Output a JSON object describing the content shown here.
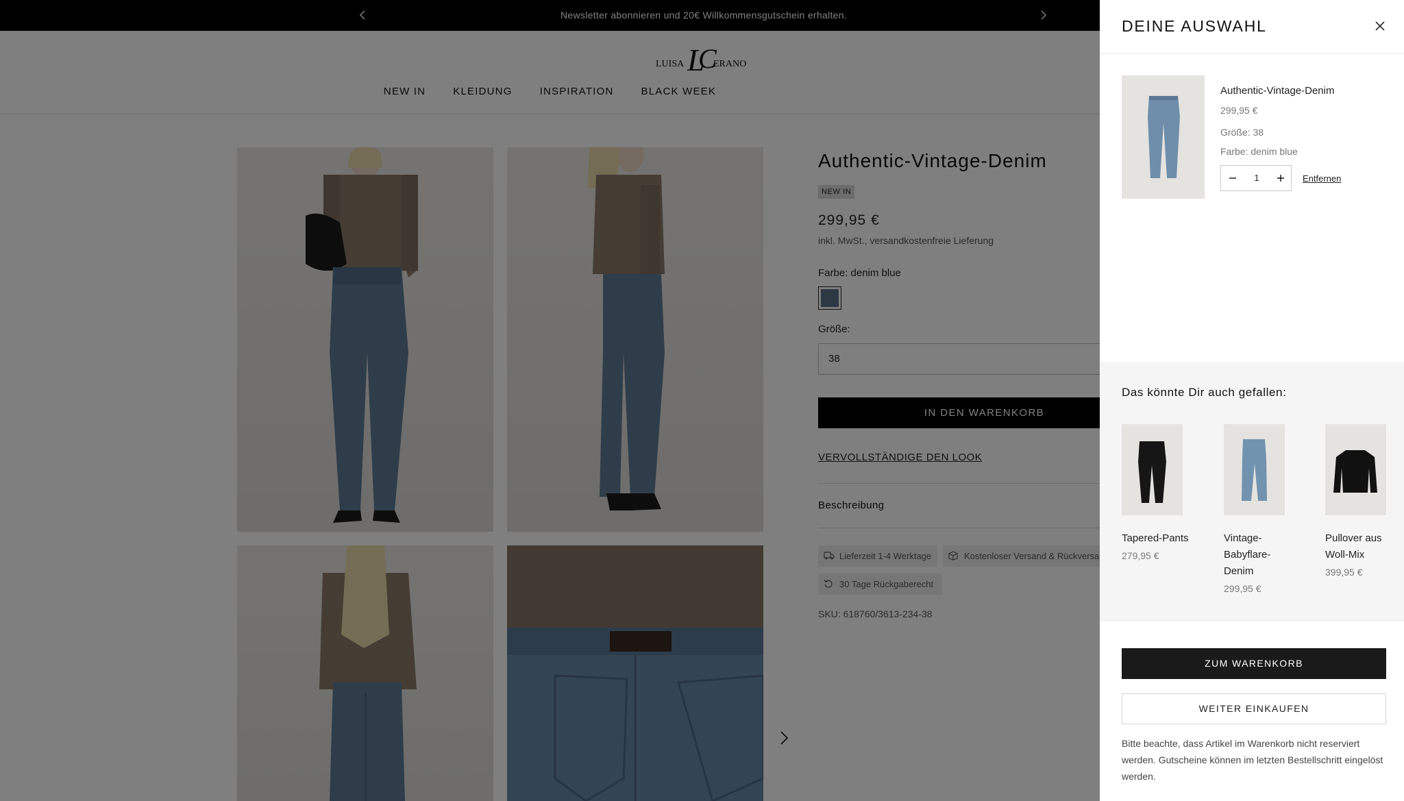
{
  "announcement": {
    "text": "Newsletter abonnieren und 20€ Willkommensgutschein erhalten."
  },
  "brand": {
    "logo_text_left": "LUISA",
    "logo_text_right": "CERANO",
    "logo_initials": "LC"
  },
  "nav": {
    "items": [
      "NEW IN",
      "KLEIDUNG",
      "INSPIRATION",
      "BLACK WEEK"
    ]
  },
  "product": {
    "title": "Authentic-Vintage-Denim",
    "badge": "NEW IN",
    "price": "299,95 €",
    "tax_note": "inkl. MwSt., versandkostenfreie Lieferung",
    "color_label": "Farbe: denim blue",
    "color_swatch": "#5b7186",
    "size_label": "Größe:",
    "size_value": "38",
    "add_to_cart": "IN DEN WARENKORB",
    "complete_look": "VERVOLLSTÄNDIGE DEN LOOK",
    "description_label": "Beschreibung",
    "chips": [
      "Lieferzeit 1-4 Werktage",
      "Kostenloser Versand & Rückversand",
      "30 Tage Rückgaberecht"
    ],
    "sku": "SKU: 618760/3613-234-38"
  },
  "drawer": {
    "title": "DEINE AUSWAHL",
    "item": {
      "name": "Authentic-Vintage-Denim",
      "price": "299,95 €",
      "size": "Größe: 38",
      "color": "Farbe: denim blue",
      "quantity": "1",
      "remove": "Entfernen"
    },
    "recommendations": {
      "title": "Das könnte Dir auch gefallen:",
      "items": [
        {
          "name": "Tapered-Pants",
          "price": "279,95 €"
        },
        {
          "name": "Vintage-Babyflare-Denim",
          "price": "299,95 €"
        },
        {
          "name": "Pullover aus Woll-Mix",
          "price": "399,95 €"
        }
      ]
    },
    "go_to_cart": "ZUM WARENKORB",
    "continue_shopping": "WEITER EINKAUFEN",
    "note": "Bitte beachte, dass Artikel im Warenkorb nicht reserviert werden. Gutscheine können im letzten Bestellschritt eingelöst werden."
  },
  "colors": {
    "overlay": "rgba(0,0,0,0.5)",
    "dark": "#1a1a1a",
    "denim": "#5b7186"
  }
}
